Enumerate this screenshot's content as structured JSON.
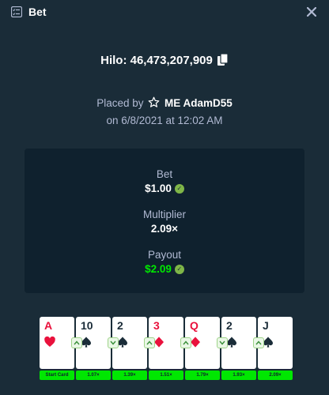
{
  "header": {
    "title": "Bet",
    "icon": "bet-list-icon",
    "close_icon": "close-icon"
  },
  "game": {
    "id_text": "Hilo: 46,473,207,909"
  },
  "placed": {
    "prefix": "Placed by",
    "user": "ME AdamD55",
    "date": "on 6/8/2021 at 12:02 AM"
  },
  "stats": {
    "bet_label": "Bet",
    "bet_value": "$1.00",
    "multiplier_label": "Multiplier",
    "multiplier_value": "2.09×",
    "payout_label": "Payout",
    "payout_value": "$2.09"
  },
  "cards": [
    {
      "rank": "A",
      "suit": "hearts",
      "color": "red",
      "arrow": null,
      "mult": "Start Card"
    },
    {
      "rank": "10",
      "suit": "spades",
      "color": "dark",
      "arrow": "up",
      "mult": "1.07×"
    },
    {
      "rank": "2",
      "suit": "spades",
      "color": "dark",
      "arrow": "down",
      "mult": "1.39×"
    },
    {
      "rank": "3",
      "suit": "diamonds",
      "color": "red",
      "arrow": "up",
      "mult": "1.51×"
    },
    {
      "rank": "Q",
      "suit": "diamonds",
      "color": "red",
      "arrow": "up",
      "mult": "1.79×"
    },
    {
      "rank": "2",
      "suit": "spades",
      "color": "dark",
      "arrow": "down",
      "mult": "1.93×"
    },
    {
      "rank": "J",
      "suit": "spades",
      "color": "dark",
      "arrow": "up",
      "mult": "2.09×"
    }
  ],
  "colors": {
    "background": "#1a2c38",
    "panel": "#0f212e",
    "accent_green": "#00e701",
    "muted": "#b1bad3",
    "red": "#e9113c"
  }
}
